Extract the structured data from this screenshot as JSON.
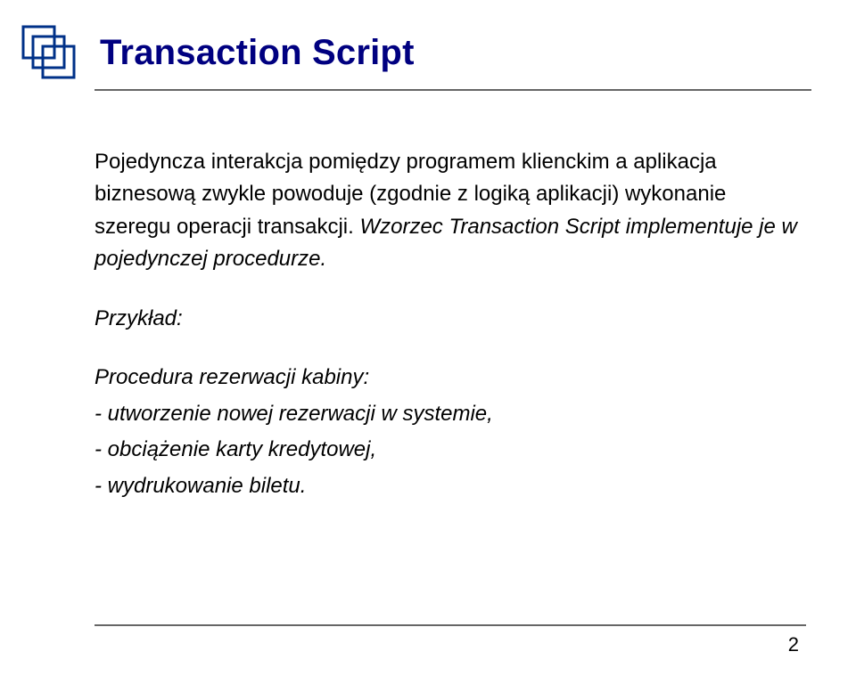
{
  "title": "Transaction Script",
  "body": {
    "paragraph1_pre": "Pojedyncza interakcja pomiędzy programem klienckim a aplikacja biznesową zwykle powoduje (zgodnie z logiką aplikacji) wykonanie szeregu operacji transakcji. ",
    "paragraph1_italic": "Wzorzec Transaction Script implementuje je w pojedynczej procedurze.",
    "example_label": "Przykład:",
    "procedure_label": "Procedura rezerwacji kabiny:",
    "items": {
      "0": "- utworzenie nowej rezerwacji w systemie,",
      "1": "- obciążenie karty kredytowej,",
      "2": "- wydrukowanie biletu."
    }
  },
  "page_number": "2"
}
